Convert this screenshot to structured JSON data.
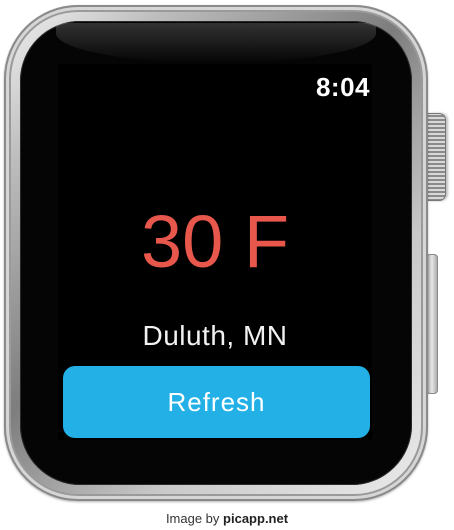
{
  "watch": {
    "time": "8:04",
    "temperature": "30 F",
    "location": "Duluth, MN",
    "refresh_label": "Refresh"
  },
  "credit": {
    "prefix": "Image by",
    "site": "picapp.net"
  },
  "colors": {
    "temperature": "#e8574b",
    "refresh_button": "#22b0e6",
    "screen_background": "#000000"
  }
}
